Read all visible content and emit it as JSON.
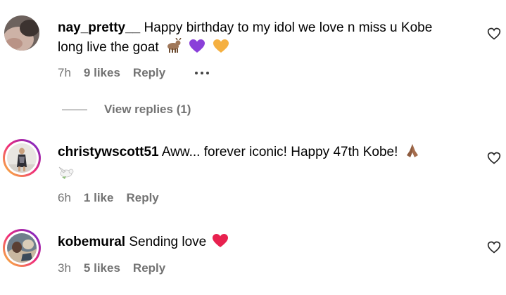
{
  "comments": [
    {
      "username": "nay_pretty__",
      "text_line1": " Happy birthday to my idol we love n miss u Kobe",
      "text_line2": "long live the goat",
      "emojis": [
        "goat-emoji",
        "purple-heart-emoji",
        "orange-heart-emoji"
      ],
      "time": "7h",
      "likes": "9 likes",
      "reply": "Reply",
      "view_replies": "View replies (1)"
    },
    {
      "username": "christywscott51",
      "text_line1": " Aww... forever iconic! Happy 47th Kobe!",
      "emojis": [
        "praying-hands-emoji",
        "dove-emoji"
      ],
      "time": "6h",
      "likes": "1 like",
      "reply": "Reply"
    },
    {
      "username": "kobemural",
      "text_line1": " Sending love",
      "emojis": [
        "red-heart-emoji"
      ],
      "time": "3h",
      "likes": "5 likes",
      "reply": "Reply"
    }
  ],
  "colors": {
    "meta_gray": "#737373",
    "story_ring_start": "#f9ce34",
    "story_ring_mid": "#ee2a7b",
    "story_ring_end": "#6228d7"
  }
}
